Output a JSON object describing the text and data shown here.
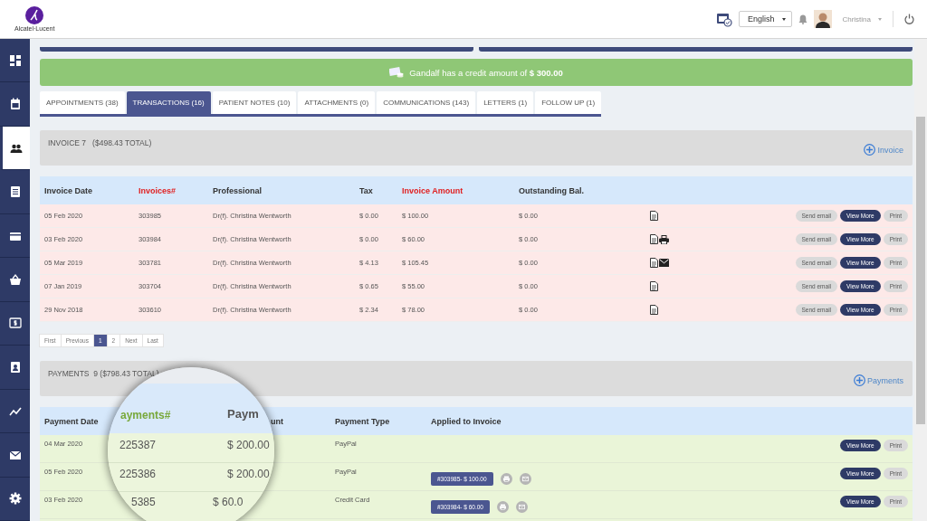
{
  "header": {
    "logo_text": "Alcatel·Lucent",
    "language": "English",
    "user_name": "Christina"
  },
  "sidebar": {
    "items": [
      {
        "kind": "dashboard",
        "selected": false
      },
      {
        "kind": "calendar",
        "selected": false
      },
      {
        "kind": "people",
        "selected": true
      },
      {
        "kind": "list",
        "selected": false
      },
      {
        "kind": "card",
        "selected": false
      },
      {
        "kind": "basket",
        "selected": false
      },
      {
        "kind": "dollar",
        "selected": false
      },
      {
        "kind": "contact",
        "selected": false
      },
      {
        "kind": "chart",
        "selected": false
      },
      {
        "kind": "mail",
        "selected": false
      },
      {
        "kind": "settings",
        "selected": false
      }
    ]
  },
  "banner": {
    "text": "Gandalf has a credit amount of **$ 300.00**"
  },
  "tabs": [
    {
      "label": "APPOINTMENTS (38)",
      "selected": false
    },
    {
      "label": "TRANSACTIONS (16)",
      "selected": true
    },
    {
      "label": "PATIENT NOTES (10)",
      "selected": false
    },
    {
      "label": "ATTACHMENTS (0)",
      "selected": false
    },
    {
      "label": "COMMUNICATIONS (143)",
      "selected": false
    },
    {
      "label": "LETTERS (1)",
      "selected": false
    },
    {
      "label": "FOLLOW UP (1)",
      "selected": false
    }
  ],
  "invoices": {
    "title": "INVOICE 7",
    "total": "($498.43 TOTAL)",
    "add_label": "Invoice",
    "columns": [
      {
        "label": "Invoice Date",
        "highlight": false
      },
      {
        "label": "Invoices#",
        "highlight": true
      },
      {
        "label": "Professional",
        "highlight": false
      },
      {
        "label": "Tax",
        "highlight": false
      },
      {
        "label": "Invoice Amount",
        "highlight": true
      },
      {
        "label": "Outstanding Bal.",
        "highlight": false
      }
    ],
    "rows": [
      {
        "cells": [
          "05 Feb 2020",
          "303985",
          "Dr(f). Christina Wentworth",
          "$ 0.00",
          "$ 100.00",
          "$ 0.00"
        ],
        "attachments": [
          {
            "kind": "document"
          }
        ],
        "actions": [
          "Send email",
          "View More",
          "Print"
        ]
      },
      {
        "cells": [
          "03 Feb 2020",
          "303984",
          "Dr(f). Christina Wentworth",
          "$ 0.00",
          "$ 60.00",
          "$ 0.00"
        ],
        "attachments": [
          {
            "kind": "document"
          },
          {
            "kind": "printer"
          }
        ],
        "actions": [
          "Send email",
          "View More",
          "Print"
        ]
      },
      {
        "cells": [
          "05 Mar 2019",
          "303781",
          "Dr(f). Christina Wentworth",
          "$ 4.13",
          "$ 105.45",
          "$ 0.00"
        ],
        "attachments": [
          {
            "kind": "document"
          },
          {
            "kind": "mail"
          }
        ],
        "actions": [
          "Send email",
          "View More",
          "Print"
        ]
      },
      {
        "cells": [
          "07 Jan 2019",
          "303704",
          "Dr(f). Christina Wentworth",
          "$ 0.65",
          "$ 55.00",
          "$ 0.00"
        ],
        "attachments": [
          {
            "kind": "document"
          }
        ],
        "actions": [
          "Send email",
          "View More",
          "Print"
        ]
      },
      {
        "cells": [
          "29 Nov 2018",
          "303610",
          "Dr(f). Christina Wentworth",
          "$ 2.34",
          "$ 78.00",
          "$ 0.00"
        ],
        "attachments": [
          {
            "kind": "document"
          }
        ],
        "actions": [
          "Send email",
          "View More",
          "Print"
        ]
      }
    ],
    "pagination": {
      "first": "First",
      "previous": "Previous",
      "pages": [
        {
          "label": "1",
          "selected": true
        },
        {
          "label": "2",
          "selected": false
        }
      ],
      "next": "Next",
      "last": "Last"
    }
  },
  "payments": {
    "title": "PAYMENTS  9 ($798.43 TOTAL)",
    "add_label": "Payments",
    "headings": {
      "date": "Payment Date",
      "amount_tail": "unt",
      "type": "Payment Type",
      "applied": "Applied to Invoice"
    },
    "rows": [
      {
        "date": "04 Mar 2020",
        "type": "PayPal",
        "actions": [
          "View More",
          "Print"
        ]
      },
      {
        "date": "05 Feb 2020",
        "type": "PayPal",
        "applied": "#303985- $ 100.00",
        "actions": [
          "View More",
          "Print"
        ]
      },
      {
        "date": "03 Feb 2020",
        "type": "Credit Card",
        "applied": "#303984- $ 60.00",
        "actions": [
          "View More",
          "Print"
        ]
      }
    ],
    "magnifier": {
      "number_heading": "ayments#",
      "amount_heading": "Paym",
      "rows": [
        {
          "number": "225387",
          "amount": "$ 200.00"
        },
        {
          "number": "225386",
          "amount": "$ 200.00"
        },
        {
          "number": "5385",
          "amount": "$ 60.0"
        }
      ]
    }
  }
}
